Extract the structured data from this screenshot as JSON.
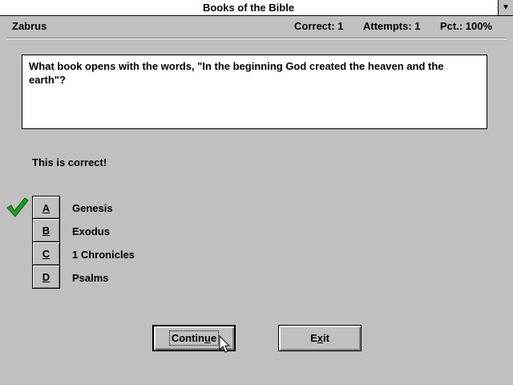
{
  "window": {
    "title": "Books of the Bible",
    "menu_icon": "down-arrow-icon"
  },
  "status": {
    "player": "Zabrus",
    "correct": "Correct: 1",
    "attempts": "Attempts: 1",
    "pct": "Pct.: 100%"
  },
  "question": {
    "text": "What book opens with the words, \"In the beginning God created the heaven and the earth\"?"
  },
  "feedback": "This is correct!",
  "answers": [
    {
      "letter": "A",
      "text": "Genesis",
      "correct": true
    },
    {
      "letter": "B",
      "text": "Exodus"
    },
    {
      "letter": "C",
      "text": "1 Chronicles"
    },
    {
      "letter": "D",
      "text": "Psalms"
    }
  ],
  "buttons": {
    "continue": {
      "pre": "Contin",
      "accel": "u",
      "post": "e"
    },
    "exit": {
      "pre": "E",
      "accel": "x",
      "post": "it"
    }
  },
  "colors": {
    "background": "#c0c0c0",
    "check": "#20a020"
  }
}
